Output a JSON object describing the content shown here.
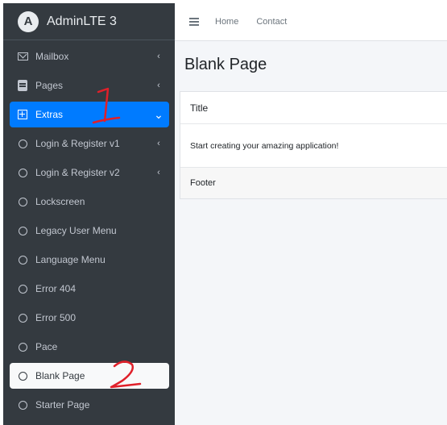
{
  "brand": {
    "title": "AdminLTE 3",
    "logo_letter": "A"
  },
  "sidebar": {
    "items": [
      {
        "label": "Mailbox",
        "icon": "envelope-icon",
        "chevron": "‹"
      },
      {
        "label": "Pages",
        "icon": "page-icon",
        "chevron": "‹"
      },
      {
        "label": "Extras",
        "icon": "plus-square-icon",
        "chevron": "⌄",
        "active": true
      },
      {
        "label": "Login & Register v1",
        "icon": "circle-icon",
        "chevron": "‹"
      },
      {
        "label": "Login & Register v2",
        "icon": "circle-icon",
        "chevron": "‹"
      },
      {
        "label": "Lockscreen",
        "icon": "circle-icon"
      },
      {
        "label": "Legacy User Menu",
        "icon": "circle-icon"
      },
      {
        "label": "Language Menu",
        "icon": "circle-icon"
      },
      {
        "label": "Error 404",
        "icon": "circle-icon"
      },
      {
        "label": "Error 500",
        "icon": "circle-icon"
      },
      {
        "label": "Pace",
        "icon": "circle-icon"
      },
      {
        "label": "Blank Page",
        "icon": "circle-icon",
        "highlighted": true
      },
      {
        "label": "Starter Page",
        "icon": "circle-icon"
      }
    ]
  },
  "topbar": {
    "menu_icon": "hamburger-icon",
    "links": [
      "Home",
      "Contact"
    ]
  },
  "main": {
    "page_title": "Blank Page",
    "card": {
      "header": "Title",
      "body": "Start creating your amazing application!",
      "footer": "Footer"
    }
  },
  "annotations": [
    "1",
    "2"
  ],
  "colors": {
    "sidebar": "#343a40",
    "active": "#007bff",
    "annotation": "#e0202a",
    "content_bg": "#f4f6f9"
  }
}
